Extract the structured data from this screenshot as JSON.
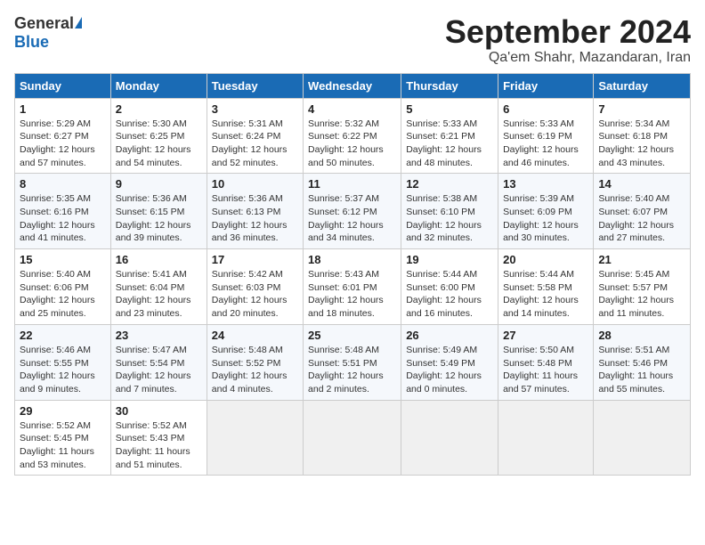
{
  "header": {
    "logo_general": "General",
    "logo_blue": "Blue",
    "title": "September 2024",
    "location": "Qa'em Shahr, Mazandaran, Iran"
  },
  "weekdays": [
    "Sunday",
    "Monday",
    "Tuesday",
    "Wednesday",
    "Thursday",
    "Friday",
    "Saturday"
  ],
  "weeks": [
    [
      {
        "day": "1",
        "sunrise": "Sunrise: 5:29 AM",
        "sunset": "Sunset: 6:27 PM",
        "daylight": "Daylight: 12 hours and 57 minutes."
      },
      {
        "day": "2",
        "sunrise": "Sunrise: 5:30 AM",
        "sunset": "Sunset: 6:25 PM",
        "daylight": "Daylight: 12 hours and 54 minutes."
      },
      {
        "day": "3",
        "sunrise": "Sunrise: 5:31 AM",
        "sunset": "Sunset: 6:24 PM",
        "daylight": "Daylight: 12 hours and 52 minutes."
      },
      {
        "day": "4",
        "sunrise": "Sunrise: 5:32 AM",
        "sunset": "Sunset: 6:22 PM",
        "daylight": "Daylight: 12 hours and 50 minutes."
      },
      {
        "day": "5",
        "sunrise": "Sunrise: 5:33 AM",
        "sunset": "Sunset: 6:21 PM",
        "daylight": "Daylight: 12 hours and 48 minutes."
      },
      {
        "day": "6",
        "sunrise": "Sunrise: 5:33 AM",
        "sunset": "Sunset: 6:19 PM",
        "daylight": "Daylight: 12 hours and 46 minutes."
      },
      {
        "day": "7",
        "sunrise": "Sunrise: 5:34 AM",
        "sunset": "Sunset: 6:18 PM",
        "daylight": "Daylight: 12 hours and 43 minutes."
      }
    ],
    [
      {
        "day": "8",
        "sunrise": "Sunrise: 5:35 AM",
        "sunset": "Sunset: 6:16 PM",
        "daylight": "Daylight: 12 hours and 41 minutes."
      },
      {
        "day": "9",
        "sunrise": "Sunrise: 5:36 AM",
        "sunset": "Sunset: 6:15 PM",
        "daylight": "Daylight: 12 hours and 39 minutes."
      },
      {
        "day": "10",
        "sunrise": "Sunrise: 5:36 AM",
        "sunset": "Sunset: 6:13 PM",
        "daylight": "Daylight: 12 hours and 36 minutes."
      },
      {
        "day": "11",
        "sunrise": "Sunrise: 5:37 AM",
        "sunset": "Sunset: 6:12 PM",
        "daylight": "Daylight: 12 hours and 34 minutes."
      },
      {
        "day": "12",
        "sunrise": "Sunrise: 5:38 AM",
        "sunset": "Sunset: 6:10 PM",
        "daylight": "Daylight: 12 hours and 32 minutes."
      },
      {
        "day": "13",
        "sunrise": "Sunrise: 5:39 AM",
        "sunset": "Sunset: 6:09 PM",
        "daylight": "Daylight: 12 hours and 30 minutes."
      },
      {
        "day": "14",
        "sunrise": "Sunrise: 5:40 AM",
        "sunset": "Sunset: 6:07 PM",
        "daylight": "Daylight: 12 hours and 27 minutes."
      }
    ],
    [
      {
        "day": "15",
        "sunrise": "Sunrise: 5:40 AM",
        "sunset": "Sunset: 6:06 PM",
        "daylight": "Daylight: 12 hours and 25 minutes."
      },
      {
        "day": "16",
        "sunrise": "Sunrise: 5:41 AM",
        "sunset": "Sunset: 6:04 PM",
        "daylight": "Daylight: 12 hours and 23 minutes."
      },
      {
        "day": "17",
        "sunrise": "Sunrise: 5:42 AM",
        "sunset": "Sunset: 6:03 PM",
        "daylight": "Daylight: 12 hours and 20 minutes."
      },
      {
        "day": "18",
        "sunrise": "Sunrise: 5:43 AM",
        "sunset": "Sunset: 6:01 PM",
        "daylight": "Daylight: 12 hours and 18 minutes."
      },
      {
        "day": "19",
        "sunrise": "Sunrise: 5:44 AM",
        "sunset": "Sunset: 6:00 PM",
        "daylight": "Daylight: 12 hours and 16 minutes."
      },
      {
        "day": "20",
        "sunrise": "Sunrise: 5:44 AM",
        "sunset": "Sunset: 5:58 PM",
        "daylight": "Daylight: 12 hours and 14 minutes."
      },
      {
        "day": "21",
        "sunrise": "Sunrise: 5:45 AM",
        "sunset": "Sunset: 5:57 PM",
        "daylight": "Daylight: 12 hours and 11 minutes."
      }
    ],
    [
      {
        "day": "22",
        "sunrise": "Sunrise: 5:46 AM",
        "sunset": "Sunset: 5:55 PM",
        "daylight": "Daylight: 12 hours and 9 minutes."
      },
      {
        "day": "23",
        "sunrise": "Sunrise: 5:47 AM",
        "sunset": "Sunset: 5:54 PM",
        "daylight": "Daylight: 12 hours and 7 minutes."
      },
      {
        "day": "24",
        "sunrise": "Sunrise: 5:48 AM",
        "sunset": "Sunset: 5:52 PM",
        "daylight": "Daylight: 12 hours and 4 minutes."
      },
      {
        "day": "25",
        "sunrise": "Sunrise: 5:48 AM",
        "sunset": "Sunset: 5:51 PM",
        "daylight": "Daylight: 12 hours and 2 minutes."
      },
      {
        "day": "26",
        "sunrise": "Sunrise: 5:49 AM",
        "sunset": "Sunset: 5:49 PM",
        "daylight": "Daylight: 12 hours and 0 minutes."
      },
      {
        "day": "27",
        "sunrise": "Sunrise: 5:50 AM",
        "sunset": "Sunset: 5:48 PM",
        "daylight": "Daylight: 11 hours and 57 minutes."
      },
      {
        "day": "28",
        "sunrise": "Sunrise: 5:51 AM",
        "sunset": "Sunset: 5:46 PM",
        "daylight": "Daylight: 11 hours and 55 minutes."
      }
    ],
    [
      {
        "day": "29",
        "sunrise": "Sunrise: 5:52 AM",
        "sunset": "Sunset: 5:45 PM",
        "daylight": "Daylight: 11 hours and 53 minutes."
      },
      {
        "day": "30",
        "sunrise": "Sunrise: 5:52 AM",
        "sunset": "Sunset: 5:43 PM",
        "daylight": "Daylight: 11 hours and 51 minutes."
      },
      null,
      null,
      null,
      null,
      null
    ]
  ]
}
